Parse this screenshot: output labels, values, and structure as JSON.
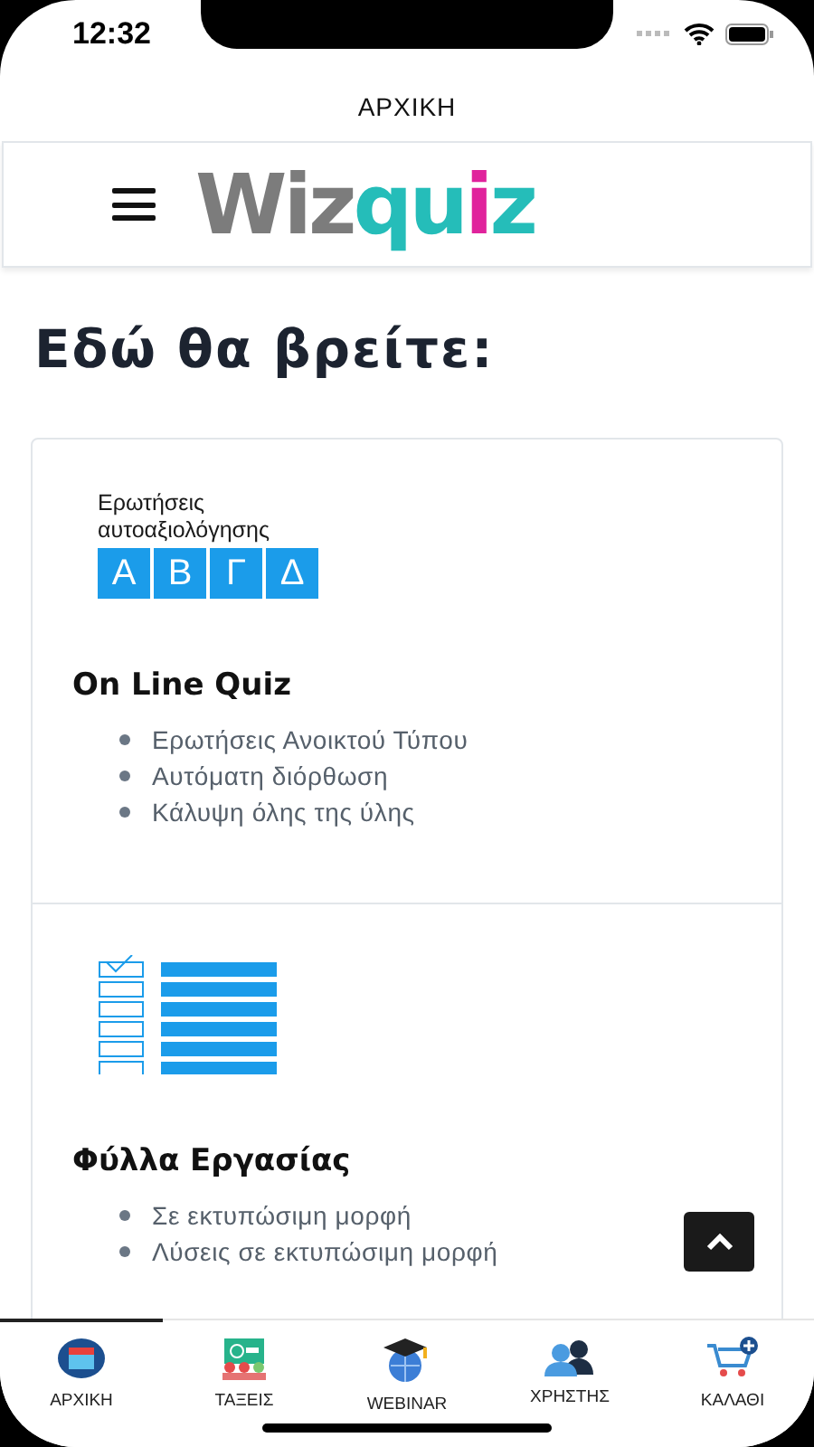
{
  "status_bar": {
    "time": "12:32"
  },
  "page_title": "ΑΡΧΙΚΗ",
  "header": {
    "logo": {
      "part_1": "Wiz",
      "part_2": "qu",
      "part_3": "i",
      "part_4": "z"
    }
  },
  "heading": "Εδώ θα βρείτε:",
  "sections": [
    {
      "kind": "quiz",
      "image_caption": "Ερωτήσεις αυτοαξιολόγησης",
      "image_letters": [
        "Α",
        "Β",
        "Γ",
        "Δ"
      ],
      "title": "On Line Quiz",
      "items": [
        "Ερωτήσεις Ανοικτού Τύπου",
        "Αυτόματη διόρθωση",
        "Κάλυψη όλης της ύλης"
      ]
    },
    {
      "kind": "worksheet",
      "title": "Φύλλα Εργασίας",
      "items": [
        "Σε εκτυπώσιμη μορφή",
        "Λύσεις σε εκτυπώσιμη μορφή"
      ]
    }
  ],
  "tabs": [
    {
      "label": "ΑΡΧΙΚΗ",
      "kind": "home",
      "selected": true
    },
    {
      "label": "ΤΑΞΕΙΣ",
      "kind": "classes",
      "selected": false
    },
    {
      "label": "WEBINAR",
      "kind": "webinar",
      "selected": false
    },
    {
      "label": "ΧΡΗΣΤΗΣ",
      "kind": "user",
      "selected": false
    },
    {
      "label": "ΚΑΛΑΘΙ",
      "kind": "cart",
      "selected": false
    }
  ]
}
